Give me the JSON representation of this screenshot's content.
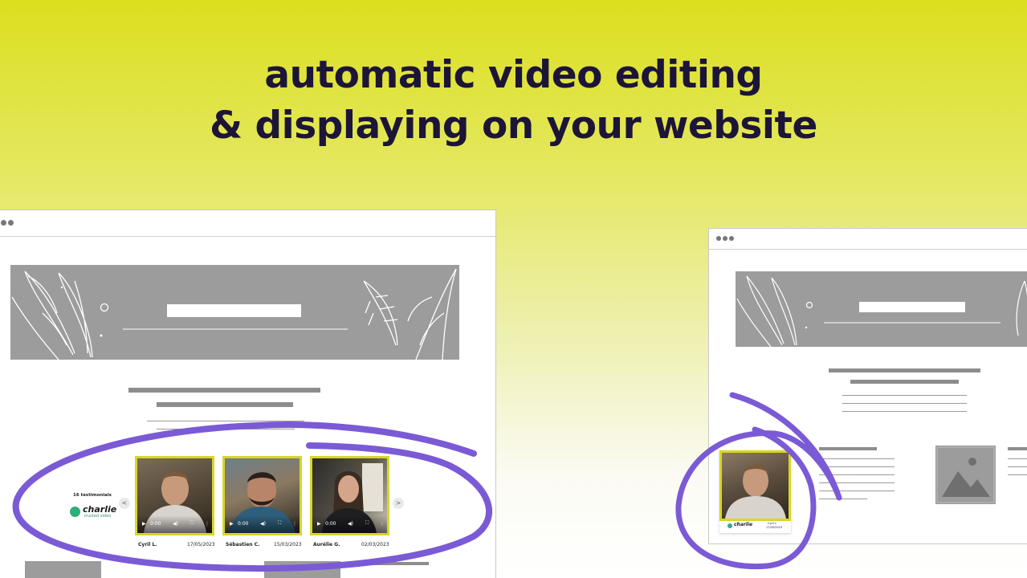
{
  "headline": {
    "line1": "automatic video editing",
    "line2": "& displaying on your website"
  },
  "widget": {
    "count_label": "16 testimonials",
    "brand_name": "charlie",
    "brand_tagline": "trusted video",
    "prev_arrow": "<",
    "next_arrow": ">",
    "videos": [
      {
        "name": "Cyril L.",
        "date": "17/05/2023",
        "time": "0:00"
      },
      {
        "name": "Sébastien C.",
        "date": "15/03/2023",
        "time": "0:00"
      },
      {
        "name": "Aurélie G.",
        "date": "02/03/2023",
        "time": "0:00"
      }
    ]
  },
  "mini_widget": {
    "brand_name": "charlie",
    "name": "Cyril L.",
    "date": "17/05/2023"
  },
  "colors": {
    "accent_yellow": "#dcdf1e",
    "headline_navy": "#1c1537",
    "circle_purple": "#7b5ad6",
    "brand_green": "#2fae7d",
    "placeholder_gray": "#9c9c9c"
  },
  "icons": [
    "play-icon",
    "volume-icon",
    "fullscreen-icon",
    "more-icon",
    "image-placeholder-icon",
    "leaf-icon"
  ]
}
